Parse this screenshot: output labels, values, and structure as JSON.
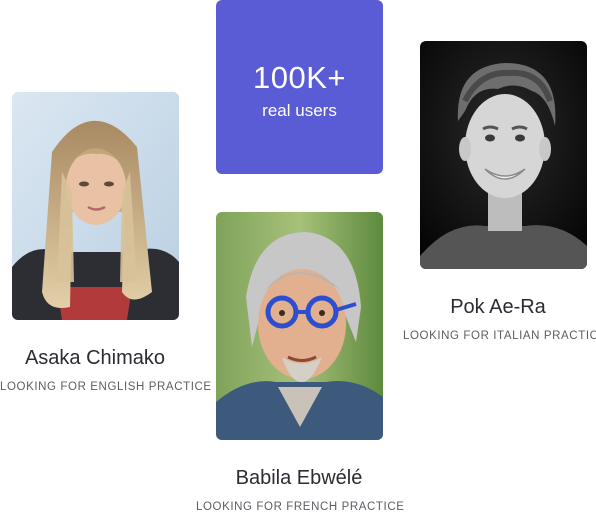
{
  "stats": {
    "value": "100K+",
    "label": "real users",
    "card_color": "#5a5cd6"
  },
  "people": [
    {
      "name": "Asaka Chimako",
      "subtitle": "LOOKING FOR ENGLISH PRACTICE",
      "photo": "portrait-woman-blonde-hair"
    },
    {
      "name": "Babila Ebwélé",
      "subtitle": "LOOKING FOR FRENCH PRACTICE",
      "photo": "portrait-man-gray-hair-blue-glasses"
    },
    {
      "name": "Pok Ae-Ra",
      "subtitle": "LOOKING FOR ITALIAN PRACTICE",
      "photo": "portrait-man-curly-hair-black-white"
    }
  ]
}
